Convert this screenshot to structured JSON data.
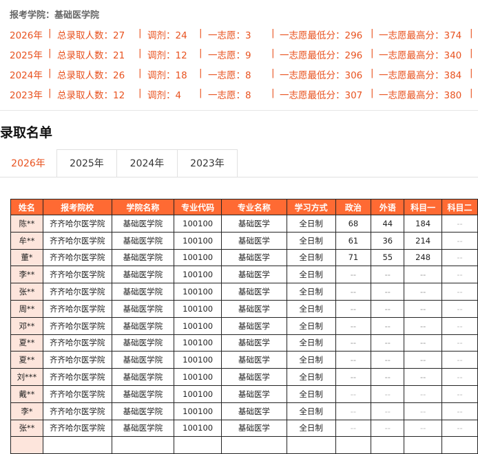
{
  "college_line": "报考学院：基础医学院",
  "stats": [
    {
      "year": "2026年",
      "total": "总录取人数：27",
      "adjust": "调剂：24",
      "first": "一志愿：3",
      "min": "一志愿最低分：296",
      "max": "一志愿最高分：374"
    },
    {
      "year": "2025年",
      "total": "总录取人数：21",
      "adjust": "调剂：12",
      "first": "一志愿：9",
      "min": "一志愿最低分：296",
      "max": "一志愿最高分：340"
    },
    {
      "year": "2024年",
      "total": "总录取人数：26",
      "adjust": "调剂：18",
      "first": "一志愿：8",
      "min": "一志愿最低分：306",
      "max": "一志愿最高分：384"
    },
    {
      "year": "2023年",
      "total": "总录取人数：12",
      "adjust": "调剂：4",
      "first": "一志愿：8",
      "min": "一志愿最低分：307",
      "max": "一志愿最高分：380"
    }
  ],
  "separator": "|",
  "section_title": "录取名单",
  "tabs": [
    "2026年",
    "2025年",
    "2024年",
    "2023年"
  ],
  "active_tab": "2026年",
  "table": {
    "headers": [
      "姓名",
      "报考院校",
      "学院名称",
      "专业代码",
      "专业名称",
      "学习方式",
      "政治",
      "外语",
      "科目一",
      "科目二"
    ],
    "rows": [
      [
        "陈**",
        "齐齐哈尔医学院",
        "基础医学院",
        "100100",
        "基础医学",
        "全日制",
        "68",
        "44",
        "184",
        "--"
      ],
      [
        "牟**",
        "齐齐哈尔医学院",
        "基础医学院",
        "100100",
        "基础医学",
        "全日制",
        "61",
        "36",
        "214",
        "--"
      ],
      [
        "董*",
        "齐齐哈尔医学院",
        "基础医学院",
        "100100",
        "基础医学",
        "全日制",
        "71",
        "55",
        "248",
        "--"
      ],
      [
        "李**",
        "齐齐哈尔医学院",
        "基础医学院",
        "100100",
        "基础医学",
        "全日制",
        "--",
        "--",
        "--",
        "--"
      ],
      [
        "张**",
        "齐齐哈尔医学院",
        "基础医学院",
        "100100",
        "基础医学",
        "全日制",
        "--",
        "--",
        "--",
        "--"
      ],
      [
        "周**",
        "齐齐哈尔医学院",
        "基础医学院",
        "100100",
        "基础医学",
        "全日制",
        "--",
        "--",
        "--",
        "--"
      ],
      [
        "邓**",
        "齐齐哈尔医学院",
        "基础医学院",
        "100100",
        "基础医学",
        "全日制",
        "--",
        "--",
        "--",
        "--"
      ],
      [
        "夏**",
        "齐齐哈尔医学院",
        "基础医学院",
        "100100",
        "基础医学",
        "全日制",
        "--",
        "--",
        "--",
        "--"
      ],
      [
        "夏**",
        "齐齐哈尔医学院",
        "基础医学院",
        "100100",
        "基础医学",
        "全日制",
        "--",
        "--",
        "--",
        "--"
      ],
      [
        "刘***",
        "齐齐哈尔医学院",
        "基础医学院",
        "100100",
        "基础医学",
        "全日制",
        "--",
        "--",
        "--",
        "--"
      ],
      [
        "戴**",
        "齐齐哈尔医学院",
        "基础医学院",
        "100100",
        "基础医学",
        "全日制",
        "--",
        "--",
        "--",
        "--"
      ],
      [
        "李*",
        "齐齐哈尔医学院",
        "基础医学院",
        "100100",
        "基础医学",
        "全日制",
        "--",
        "--",
        "--",
        "--"
      ],
      [
        "张**",
        "齐齐哈尔医学院",
        "基础医学院",
        "100100",
        "基础医学",
        "全日制",
        "--",
        "--",
        "--",
        "--"
      ],
      [
        "",
        "",
        "",
        "",
        "",
        "",
        "",
        "",
        "",
        ""
      ]
    ]
  },
  "colors": {
    "accent": "#e8521f",
    "header_bg": "#ff6a33",
    "name_cell_bg": "#fde5dc"
  }
}
